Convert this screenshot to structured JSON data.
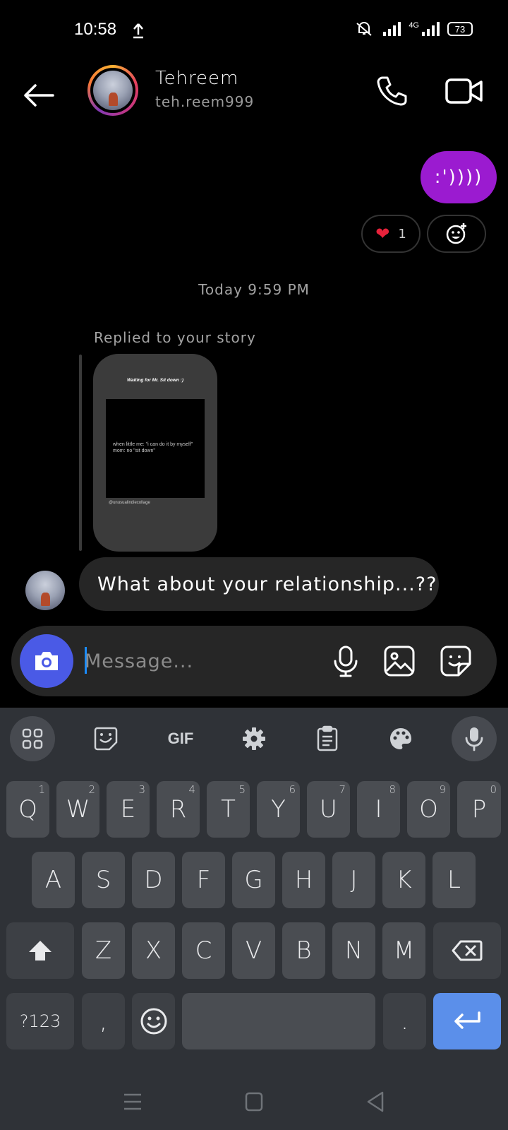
{
  "status_bar": {
    "time": "10:58",
    "signal_label": "4G",
    "battery": "73"
  },
  "header": {
    "name": "Tehreem",
    "username": "teh.reem999"
  },
  "messages": {
    "sent_text": ":'))))",
    "reaction_emoji": "❤",
    "reaction_count": "1",
    "timestamp": "Today 9:59 PM",
    "reply_label": "Replied to your story",
    "story": {
      "title": "Waiting for Mr. Sit down :)",
      "caption": "when little me: \"i can do it by myself\" mom: no \"sit down\"",
      "handle": "@unusualindiecollage"
    },
    "received_text": "What about your relationship...??"
  },
  "composer": {
    "placeholder": "Message..."
  },
  "keyboard": {
    "gif_label": "GIF",
    "row1": [
      {
        "label": "Q",
        "hint": "1"
      },
      {
        "label": "W",
        "hint": "2"
      },
      {
        "label": "E",
        "hint": "3"
      },
      {
        "label": "R",
        "hint": "4"
      },
      {
        "label": "T",
        "hint": "5"
      },
      {
        "label": "Y",
        "hint": "6"
      },
      {
        "label": "U",
        "hint": "7"
      },
      {
        "label": "I",
        "hint": "8"
      },
      {
        "label": "O",
        "hint": "9"
      },
      {
        "label": "P",
        "hint": "0"
      }
    ],
    "row2": [
      "A",
      "S",
      "D",
      "F",
      "G",
      "H",
      "J",
      "K",
      "L"
    ],
    "row3": [
      "Z",
      "X",
      "C",
      "V",
      "B",
      "N",
      "M"
    ],
    "symbols_label": "?123",
    "comma_label": ",",
    "period_label": "."
  }
}
